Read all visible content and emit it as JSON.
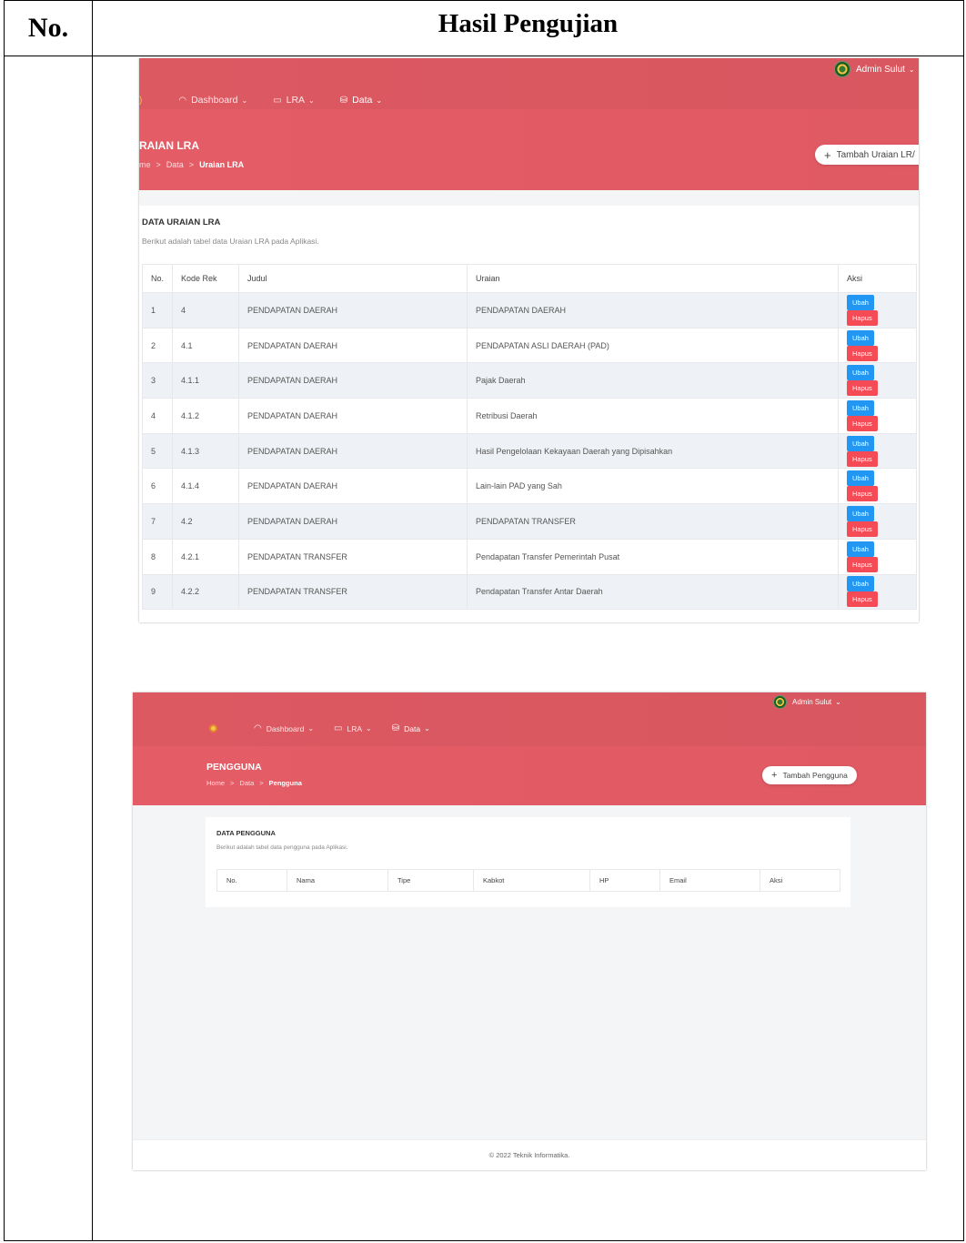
{
  "doc": {
    "header_no": "No.",
    "header_result": "Hasil Pengujian"
  },
  "shot1": {
    "user": "Admin Sulut",
    "nav": [
      "Dashboard",
      "LRA",
      "Data"
    ],
    "page_title": "RAIAN LRA",
    "breadcrumb": [
      "me",
      ">",
      "Data",
      ">",
      "Uraian LRA"
    ],
    "add_button": "Tambah Uraian LR/",
    "card_title": "DATA URAIAN LRA",
    "card_subtitle": "Berikut adalah tabel data Uraian LRA pada Aplikasi.",
    "columns": [
      "No.",
      "Kode Rek",
      "Judul",
      "Uraian",
      "Aksi"
    ],
    "rows": [
      [
        "1",
        "4",
        "PENDAPATAN DAERAH",
        "PENDAPATAN DAERAH"
      ],
      [
        "2",
        "4.1",
        "PENDAPATAN DAERAH",
        "PENDAPATAN ASLI DAERAH (PAD)"
      ],
      [
        "3",
        "4.1.1",
        "PENDAPATAN DAERAH",
        "Pajak Daerah"
      ],
      [
        "4",
        "4.1.2",
        "PENDAPATAN DAERAH",
        "Retribusi Daerah"
      ],
      [
        "5",
        "4.1.3",
        "PENDAPATAN DAERAH",
        "Hasil Pengelolaan Kekayaan Daerah yang Dipisahkan"
      ],
      [
        "6",
        "4.1.4",
        "PENDAPATAN DAERAH",
        "Lain-lain PAD yang Sah"
      ],
      [
        "7",
        "4.2",
        "PENDAPATAN DAERAH",
        "PENDAPATAN TRANSFER"
      ],
      [
        "8",
        "4.2.1",
        "PENDAPATAN TRANSFER",
        "Pendapatan Transfer Pemerintah Pusat"
      ],
      [
        "9",
        "4.2.2",
        "PENDAPATAN TRANSFER",
        "Pendapatan Transfer Antar Daerah"
      ]
    ],
    "edit_label": "Ubah",
    "delete_label": "Hapus"
  },
  "shot2": {
    "user": "Admin Sulut",
    "nav": [
      "Dashboard",
      "LRA",
      "Data"
    ],
    "page_title": "PENGGUNA",
    "breadcrumb": [
      "Home",
      ">",
      "Data",
      ">",
      "Pengguna"
    ],
    "add_button": "Tambah Pengguna",
    "card_title": "DATA PENGGUNA",
    "card_subtitle": "Berikut adalah tabel data pengguna pada Aplikasi.",
    "columns": [
      "No.",
      "Nama",
      "Tipe",
      "Kabkot",
      "HP",
      "Email",
      "Aksi"
    ],
    "footer": "© 2022 Teknik Informatika."
  },
  "colors": {
    "brand": "#e05a63",
    "edit": "#2196f3",
    "delete": "#f44b56"
  }
}
